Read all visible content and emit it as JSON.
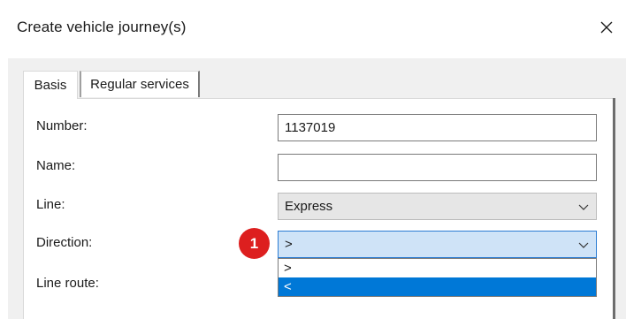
{
  "window": {
    "title": "Create vehicle journey(s)",
    "close_icon": "close-icon"
  },
  "tabs": [
    {
      "label": "Basis",
      "active": true
    },
    {
      "label": "Regular services",
      "active": false
    }
  ],
  "form": {
    "number": {
      "label": "Number:",
      "value": "1137019"
    },
    "name": {
      "label": "Name:",
      "value": ""
    },
    "line": {
      "label": "Line:",
      "value": "Express"
    },
    "direction": {
      "label": "Direction:",
      "value": ">",
      "options": [
        ">",
        "<"
      ],
      "highlighted_option": "<"
    },
    "line_route": {
      "label": "Line route:"
    }
  },
  "callout": {
    "number": "1",
    "color": "#dd1f1f"
  },
  "colors": {
    "selection": "#0078d7",
    "focused_combo": "#cfe3f7"
  }
}
